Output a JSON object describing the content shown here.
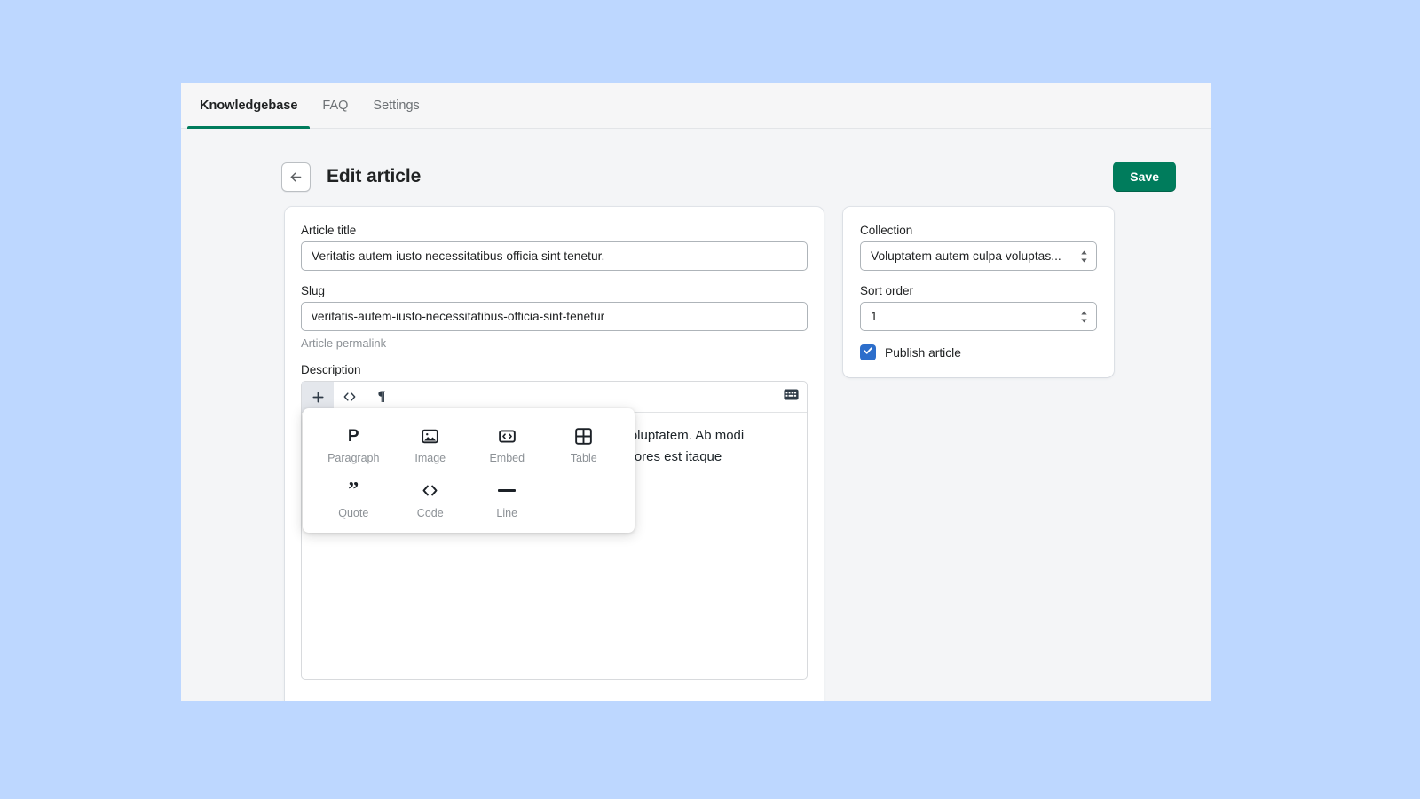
{
  "theme": {
    "page_background": "#bdd7ff",
    "app_background": "#f4f5f7",
    "accent_green": "#007c5c",
    "checkbox_blue": "#2c6ecb",
    "text_primary": "#202223",
    "text_subdued": "#8c9196"
  },
  "tabs": [
    {
      "label": "Knowledgebase",
      "active": true
    },
    {
      "label": "FAQ",
      "active": false
    },
    {
      "label": "Settings",
      "active": false
    }
  ],
  "header": {
    "back_icon": "arrow-left-icon",
    "title": "Edit article",
    "save_label": "Save"
  },
  "main": {
    "title_field": {
      "label": "Article title",
      "value": "Veritatis autem iusto necessitatibus officia sint tenetur.",
      "placeholder": "Article title"
    },
    "slug_field": {
      "label": "Slug",
      "value": "veritatis-autem-iusto-necessitatibus-officia-sint-tenetur",
      "placeholder": "Slug",
      "help": "Article permalink"
    },
    "description_field": {
      "label": "Description"
    },
    "editor": {
      "toolbar": [
        {
          "name": "add-block-button",
          "glyph": "+",
          "active": true
        },
        {
          "name": "code-button",
          "glyph": "<>",
          "active": false
        },
        {
          "name": "paragraph-button",
          "glyph": "¶",
          "active": false
        }
      ],
      "keyboard_icon": "keyboard-icon",
      "content_line_1": "imi voluptatem. Ab modi",
      "content_line_2": "s maiores est itaque"
    },
    "block_popup": {
      "items": [
        {
          "label": "Paragraph",
          "icon": "paragraph-icon"
        },
        {
          "label": "Image",
          "icon": "image-icon"
        },
        {
          "label": "Embed",
          "icon": "embed-icon"
        },
        {
          "label": "Table",
          "icon": "table-icon"
        },
        {
          "label": "Quote",
          "icon": "quote-icon"
        },
        {
          "label": "Code",
          "icon": "code-icon"
        },
        {
          "label": "Line",
          "icon": "line-icon"
        }
      ]
    }
  },
  "sidebar": {
    "collection_field": {
      "label": "Collection",
      "value": "Voluptatem autem culpa voluptas..."
    },
    "sort_order_field": {
      "label": "Sort order",
      "value": "1"
    },
    "publish_checkbox": {
      "label": "Publish article",
      "checked": true
    }
  }
}
